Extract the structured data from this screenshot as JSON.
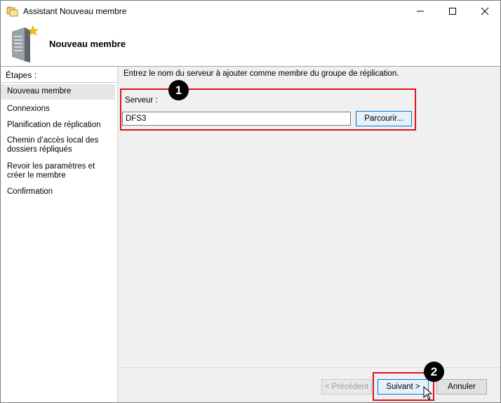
{
  "window": {
    "title": "Assistant Nouveau membre"
  },
  "header": {
    "title": "Nouveau membre"
  },
  "sidebar": {
    "title": "Étapes :",
    "items": [
      {
        "label": "Nouveau membre",
        "active": true
      },
      {
        "label": "Connexions"
      },
      {
        "label": "Planification de réplication"
      },
      {
        "label": "Chemin d’accès local des dossiers répliqués"
      },
      {
        "label": "Revoir les paramètres et créer le membre"
      },
      {
        "label": "Confirmation"
      }
    ]
  },
  "main": {
    "instruction": "Entrez le nom du serveur à ajouter comme membre du groupe de réplication.",
    "server_label": "Serveur :",
    "server_value": "DFS3",
    "browse_label": "Parcourir..."
  },
  "footer": {
    "prev_label": "< Précédent",
    "next_label": "Suivant >",
    "cancel_label": "Annuler"
  },
  "annotations": {
    "callout_1": "1",
    "callout_2": "2",
    "color": "#e0121a"
  }
}
